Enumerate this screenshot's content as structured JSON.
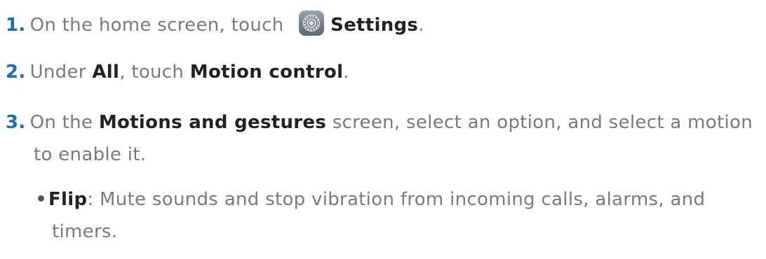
{
  "steps": [
    {
      "number": "1.",
      "text_before": "On the home screen, touch ",
      "icon": "settings-gear-icon",
      "bold": "Settings",
      "text_after": "."
    },
    {
      "number": "2.",
      "text_before": "Under ",
      "bold1": "All",
      "text_mid": ", touch ",
      "bold2": "Motion control",
      "text_after": "."
    },
    {
      "number": "3.",
      "text_before": "On the ",
      "bold": "Motions and gestures",
      "text_after": " screen, select an option, and select a motion",
      "continuation": "to enable it."
    }
  ],
  "bullets": [
    {
      "bold": "Flip",
      "text": ": Mute sounds and stop vibration from incoming calls, alarms, and",
      "continuation": "timers."
    }
  ],
  "colors": {
    "step_number": "#1a6dbe",
    "body_text": "#7a7a7a",
    "bold_text": "#222222"
  }
}
